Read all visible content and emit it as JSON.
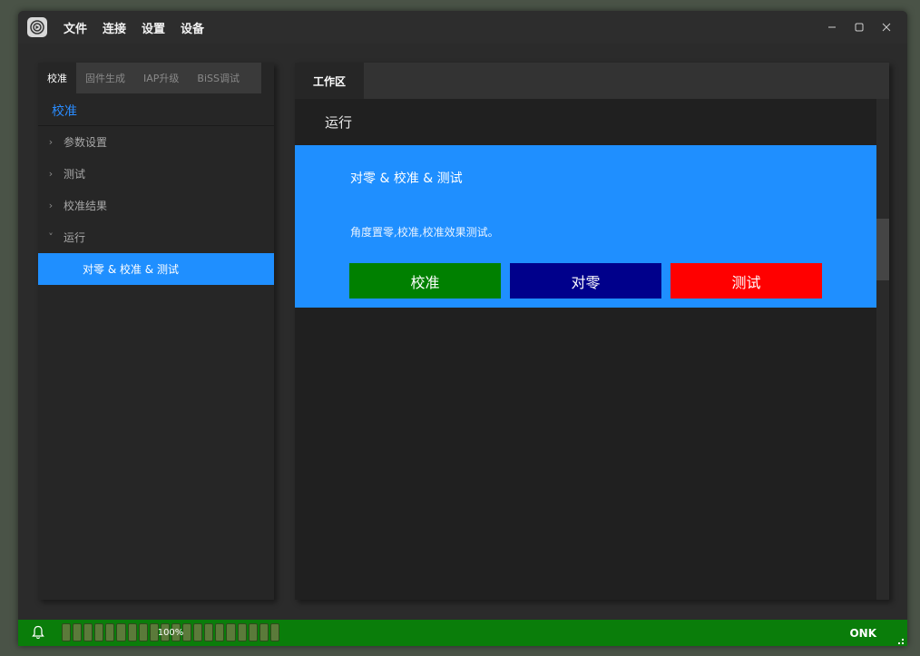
{
  "menu": {
    "file": "文件",
    "connect": "连接",
    "settings": "设置",
    "device": "设备"
  },
  "left": {
    "tabs": [
      "校准",
      "固件生成",
      "IAP升级",
      "BiSS调试"
    ],
    "section_title": "校准",
    "tree": [
      {
        "label": "参数设置",
        "chevron": "›"
      },
      {
        "label": "测试",
        "chevron": "›"
      },
      {
        "label": "校准结果",
        "chevron": "›"
      },
      {
        "label": "运行",
        "chevron": "˅"
      }
    ],
    "selected_item": "对零 & 校准 & 测试"
  },
  "right": {
    "tab": "工作区",
    "title": "运行",
    "card": {
      "title": "对零 & 校准 & 测试",
      "description": "角度置零,校准,校准效果测试。",
      "buttons": [
        {
          "label": "校准",
          "color": "#008000"
        },
        {
          "label": "对零",
          "color": "#00008b"
        },
        {
          "label": "测试",
          "color": "#ff0000"
        }
      ]
    }
  },
  "status": {
    "progress_text": "100%",
    "progress": 1.0,
    "right_text": "ONK"
  },
  "colors": {
    "accent": "#1f8fff",
    "statusbar": "#0a7d0a"
  }
}
